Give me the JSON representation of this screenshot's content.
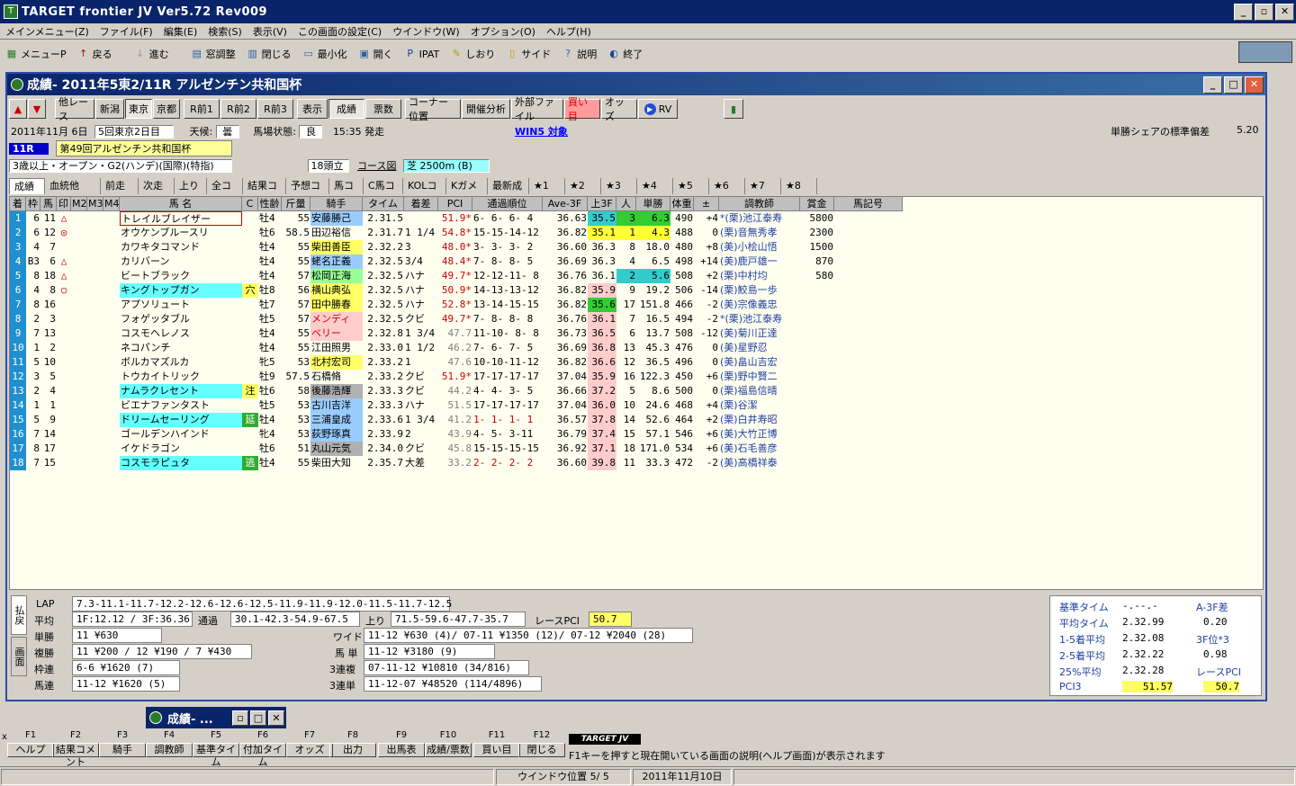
{
  "app": {
    "title": "TARGET frontier JV  Ver5.72  Rev009"
  },
  "menu": [
    "メインメニュー(Z)",
    "ファイル(F)",
    "編集(E)",
    "検索(S)",
    "表示(V)",
    "この画面の設定(C)",
    "ウインドウ(W)",
    "オプション(O)",
    "ヘルプ(H)"
  ],
  "toolbar": [
    {
      "label": "メニューP",
      "icon": "menu-icon"
    },
    {
      "label": "戻る",
      "icon": "back-arrow-icon"
    },
    {
      "label": "進む",
      "icon": "forward-arrow-icon"
    },
    {
      "label": "窓調整",
      "icon": "window-adjust-icon"
    },
    {
      "label": "閉じる",
      "icon": "close-window-icon"
    },
    {
      "label": "最小化",
      "icon": "minimize-icon"
    },
    {
      "label": "開く",
      "icon": "open-icon"
    },
    {
      "label": "IPAT",
      "icon": "ipat-icon"
    },
    {
      "label": "しおり",
      "icon": "bookmark-icon"
    },
    {
      "label": "サイド",
      "icon": "side-icon"
    },
    {
      "label": "説明",
      "icon": "help-icon"
    },
    {
      "label": "終了",
      "icon": "exit-icon"
    }
  ],
  "inner": {
    "title": "成績- 2011年5東2/11R アルゼンチン共和国杯",
    "buttons": [
      "他レース",
      "新潟",
      "東京",
      "京都",
      "R前1",
      "R前2",
      "R前3",
      "表示",
      "成績",
      "票数",
      "コーナー位置",
      "開催分析",
      "外部ファイル",
      "買い目",
      "オッズ",
      "RV"
    ],
    "date": "2011年11月 6日",
    "kai": "5回東京2日目",
    "weather_label": "天候:",
    "weather": "曇",
    "track_label": "馬場状態:",
    "track": "良",
    "start": "15:35 発走",
    "win5": "WIN5 対象",
    "share_label": "単勝シェアの標準偏差",
    "share_value": "5.20",
    "race_no": "11R",
    "race_name": "第49回アルゼンチン共和国杯",
    "cond": "3歳以上・オープン・G2(ハンデ)(国際)(特指)",
    "heads": "18頭立",
    "course_label": "コース図",
    "course": "芝  2500m (B)"
  },
  "tabs": [
    "成績",
    "血統他",
    "前走",
    "次走",
    "上り",
    "全コメ",
    "結果コメ",
    "予想コメ",
    "馬コメ",
    "C馬コメ",
    "KOLコメ",
    "Kガメモ",
    "最新成",
    "★1",
    "★2",
    "★3",
    "★4",
    "★5",
    "★6",
    "★7",
    "★8"
  ],
  "columns": [
    "着",
    "枠",
    "馬",
    "印",
    "M2",
    "M3",
    "M4",
    "馬 名",
    "C",
    "性齢",
    "斤量",
    "騎手",
    "タイム",
    "着差",
    "PCI",
    "通過順位",
    "Ave-3F",
    "上3F",
    "人",
    "単勝",
    "体重",
    "±",
    "調教師",
    "賞金",
    "馬記号"
  ],
  "rows": [
    [
      "1",
      "6",
      "11",
      "△",
      "",
      "",
      "",
      "トレイルブレイザー",
      "",
      "牡4",
      "55",
      "安藤勝己",
      "2.31.5",
      "",
      "51.9*",
      "6- 6- 6- 4",
      "36.63",
      "35.5",
      "3",
      "6.3",
      "490",
      "+4",
      "*(栗)池江泰寿",
      "5800",
      ""
    ],
    [
      "2",
      "6",
      "12",
      "◎",
      "",
      "",
      "",
      "オウケンブルースリ",
      "",
      "牡6",
      "58.5",
      "田辺裕信",
      "2.31.7",
      "1 1/4",
      "54.8*",
      "15-15-14-12",
      "36.82",
      "35.1",
      "1",
      "4.3",
      "488",
      "0",
      "(栗)音無秀孝",
      "2300",
      ""
    ],
    [
      "3",
      "4",
      "7",
      "",
      "",
      "",
      "",
      "カワキタコマンド",
      "",
      "牡4",
      "55",
      "柴田善臣",
      "2.32.2",
      "3",
      "48.0*",
      "3- 3- 3- 2",
      "36.60",
      "36.3",
      "8",
      "18.0",
      "480",
      "+8",
      "(美)小桧山悟",
      "1500",
      ""
    ],
    [
      "4",
      "B3",
      "6",
      "△",
      "",
      "",
      "",
      "カリバーン",
      "",
      "牡4",
      "55",
      "蛯名正義",
      "2.32.5",
      "3/4",
      "48.4*",
      "7- 8- 8- 5",
      "36.69",
      "36.3",
      "4",
      "6.5",
      "498",
      "+14",
      "(美)鹿戸雄一",
      "870",
      ""
    ],
    [
      "5",
      "8",
      "18",
      "△",
      "",
      "",
      "",
      "ビートブラック",
      "",
      "牡4",
      "57",
      "松岡正海",
      "2.32.5",
      "ハナ",
      "49.7*",
      "12-12-11- 8",
      "36.76",
      "36.1",
      "2",
      "5.6",
      "508",
      "+2",
      "(栗)中村均",
      "580",
      ""
    ],
    [
      "6",
      "4",
      "8",
      "○",
      "",
      "",
      "",
      "キングトップガン",
      "穴",
      "牡8",
      "56",
      "横山典弘",
      "2.32.5",
      "ハナ",
      "50.9*",
      "14-13-13-12",
      "36.82",
      "35.9",
      "9",
      "19.2",
      "506",
      "-14",
      "(栗)鮫島一歩",
      "",
      ""
    ],
    [
      "7",
      "8",
      "16",
      "",
      "",
      "",
      "",
      "アプソリュート",
      "",
      "牡7",
      "57",
      "田中勝春",
      "2.32.5",
      "ハナ",
      "52.8*",
      "13-14-15-15",
      "36.82",
      "35.6",
      "17",
      "151.8",
      "466",
      "-2",
      "(美)宗像義忠",
      "",
      ""
    ],
    [
      "8",
      "2",
      "3",
      "",
      "",
      "",
      "",
      "フォゲッタブル",
      "",
      "牡5",
      "57",
      "メンディ",
      "2.32.5",
      "クビ",
      "49.7*",
      "7- 8- 8- 8",
      "36.76",
      "36.1",
      "7",
      "16.5",
      "494",
      "-2",
      "*(栗)池江泰寿",
      "",
      ""
    ],
    [
      "9",
      "7",
      "13",
      "",
      "",
      "",
      "",
      "コスモヘレノス",
      "",
      "牡4",
      "55",
      "ベリー",
      "2.32.8",
      "1 3/4",
      "47.7",
      "11-10- 8- 8",
      "36.73",
      "36.5",
      "6",
      "13.7",
      "508",
      "-12",
      "(美)菊川正達",
      "",
      ""
    ],
    [
      "10",
      "1",
      "2",
      "",
      "",
      "",
      "",
      "ネコパンチ",
      "",
      "牡4",
      "55",
      "江田照男",
      "2.33.0",
      "1 1/2",
      "46.2",
      "7- 6- 7- 5",
      "36.69",
      "36.8",
      "13",
      "45.3",
      "476",
      "0",
      "(美)星野忍",
      "",
      ""
    ],
    [
      "11",
      "5",
      "10",
      "",
      "",
      "",
      "",
      "ボルカマズルカ",
      "",
      "牝5",
      "53",
      "北村宏司",
      "2.33.2",
      "1",
      "47.6",
      "10-10-11-12",
      "36.82",
      "36.6",
      "12",
      "36.5",
      "496",
      "0",
      "(美)畠山吉宏",
      "",
      ""
    ],
    [
      "12",
      "3",
      "5",
      "",
      "",
      "",
      "",
      "トウカイトリック",
      "",
      "牡9",
      "57.5",
      "石橋脩",
      "2.33.2",
      "クビ",
      "51.9*",
      "17-17-17-17",
      "37.04",
      "35.9",
      "16",
      "122.3",
      "450",
      "+6",
      "(栗)野中賢二",
      "",
      ""
    ],
    [
      "13",
      "2",
      "4",
      "",
      "",
      "",
      "",
      "ナムラクレセント",
      "注",
      "牡6",
      "58",
      "後藤浩輝",
      "2.33.3",
      "クビ",
      "44.2",
      "4- 4- 3- 5",
      "36.66",
      "37.2",
      "5",
      "8.6",
      "500",
      "0",
      "(栗)福島信晴",
      "",
      ""
    ],
    [
      "14",
      "1",
      "1",
      "",
      "",
      "",
      "",
      "ビエナファンタスト",
      "",
      "牡5",
      "53",
      "古川吉洋",
      "2.33.3",
      "ハナ",
      "51.5",
      "17-17-17-17",
      "37.04",
      "36.0",
      "10",
      "24.6",
      "468",
      "+4",
      "(栗)谷潔",
      "",
      ""
    ],
    [
      "15",
      "5",
      "9",
      "",
      "",
      "",
      "",
      "ドリームセーリング",
      "延",
      "牡4",
      "53",
      "三浦皇成",
      "2.33.6",
      "1 3/4",
      "41.2",
      "1- 1- 1- 1",
      "36.57",
      "37.8",
      "14",
      "52.6",
      "464",
      "+2",
      "(栗)白井寿昭",
      "",
      ""
    ],
    [
      "16",
      "7",
      "14",
      "",
      "",
      "",
      "",
      "ゴールデンハインド",
      "",
      "牝4",
      "53",
      "荻野琢真",
      "2.33.9",
      "2",
      "43.9",
      "4- 5- 3-11",
      "36.79",
      "37.4",
      "15",
      "57.1",
      "546",
      "+6",
      "(美)大竹正博",
      "",
      ""
    ],
    [
      "17",
      "8",
      "17",
      "",
      "",
      "",
      "",
      "イケドラゴン",
      "",
      "牡6",
      "51",
      "丸山元気",
      "2.34.0",
      "クビ",
      "45.8",
      "15-15-15-15",
      "36.92",
      "37.1",
      "18",
      "171.0",
      "534",
      "+6",
      "(美)石毛善彦",
      "",
      ""
    ],
    [
      "18",
      "7",
      "15",
      "",
      "",
      "",
      "",
      "コスモラピュタ",
      "逃",
      "牡4",
      "55",
      "柴田大知",
      "2.35.7",
      "大差",
      "33.2",
      "2- 2- 2- 2",
      "36.60",
      "39.8",
      "11",
      "33.3",
      "472",
      "-2",
      "(美)高橋祥泰",
      "",
      ""
    ]
  ],
  "bottom": {
    "side1": "払戻",
    "side2": "画面",
    "lap_label": "LAP",
    "lap": "7.3-11.1-11.7-12.2-12.6-12.6-12.5-11.9-11.9-12.0-11.5-11.7-12.5",
    "avg_label": "平均",
    "avg": "1F:12.12 / 3F:36.36",
    "tsuka_label": "通過",
    "tsuka": "30.1-42.3-54.9-67.5",
    "agari_label": "上り",
    "agari": "71.5-59.6-47.7-35.7",
    "rpci_label": "レースPCI",
    "rpci": "50.7",
    "tansho_label": "単勝",
    "tansho": "11 ¥630",
    "wide_label": "ワイド",
    "wide": "11-12 ¥630 (4)/ 07-11 ¥1350 (12)/ 07-12 ¥2040 (28)",
    "fukusho_label": "複勝",
    "fukusho": "11 ¥200 / 12 ¥190 / 7 ¥430",
    "umatan_label": "馬 単",
    "umatan": "11-12 ¥3180 (9)",
    "wakuren_label": "枠連",
    "wakuren": "6-6 ¥1620 (7)",
    "sanpuku_label": "3連複",
    "sanpuku": "07-11-12 ¥10810 (34/816)",
    "umaren_label": "馬連",
    "umaren": "11-12 ¥1620 (5)",
    "santan_label": "3連単",
    "santan": "11-12-07 ¥48520 (114/4896)",
    "stats": [
      {
        "l": "基準タイム",
        "v": "-.--.-",
        "l2": "A-3F差",
        "v2": ""
      },
      {
        "l": "平均タイム",
        "v": "2.32.99",
        "l2": "",
        "v2": "0.20"
      },
      {
        "l": "1-5着平均",
        "v": "2.32.08",
        "l2": "3F位*3",
        "v2": ""
      },
      {
        "l": "2-5着平均",
        "v": "2.32.22",
        "l2": "",
        "v2": "0.98"
      },
      {
        "l": "25%平均",
        "v": "2.32.28",
        "l2": "レースPCI",
        "v2": ""
      },
      {
        "l": "PCI3",
        "v": "51.57",
        "l2": "",
        "v2": "50.7"
      }
    ]
  },
  "minimized": {
    "title": "成績- ..."
  },
  "fkeys": [
    {
      "k": "F1",
      "l": "ヘルプ"
    },
    {
      "k": "F2",
      "l": "結果コメント"
    },
    {
      "k": "F3",
      "l": "騎手"
    },
    {
      "k": "F4",
      "l": "調教師"
    },
    {
      "k": "F5",
      "l": "基準タイム"
    },
    {
      "k": "F6",
      "l": "付加タイム"
    },
    {
      "k": "F7",
      "l": "オッズ"
    },
    {
      "k": "F8",
      "l": "出力"
    },
    {
      "k": "F9",
      "l": "出馬表"
    },
    {
      "k": "F10",
      "l": "成績/票数"
    },
    {
      "k": "F11",
      "l": "買い目"
    },
    {
      "k": "F12",
      "l": "閉じる"
    }
  ],
  "f_hint": "F1キーを押すと現在開いている画面の説明(ヘルプ画面)が表示されます",
  "f_logo": "TARGET JV",
  "status": {
    "window_pos": "ウインドウ位置 5/ 5",
    "date": "2011年11月10日"
  }
}
